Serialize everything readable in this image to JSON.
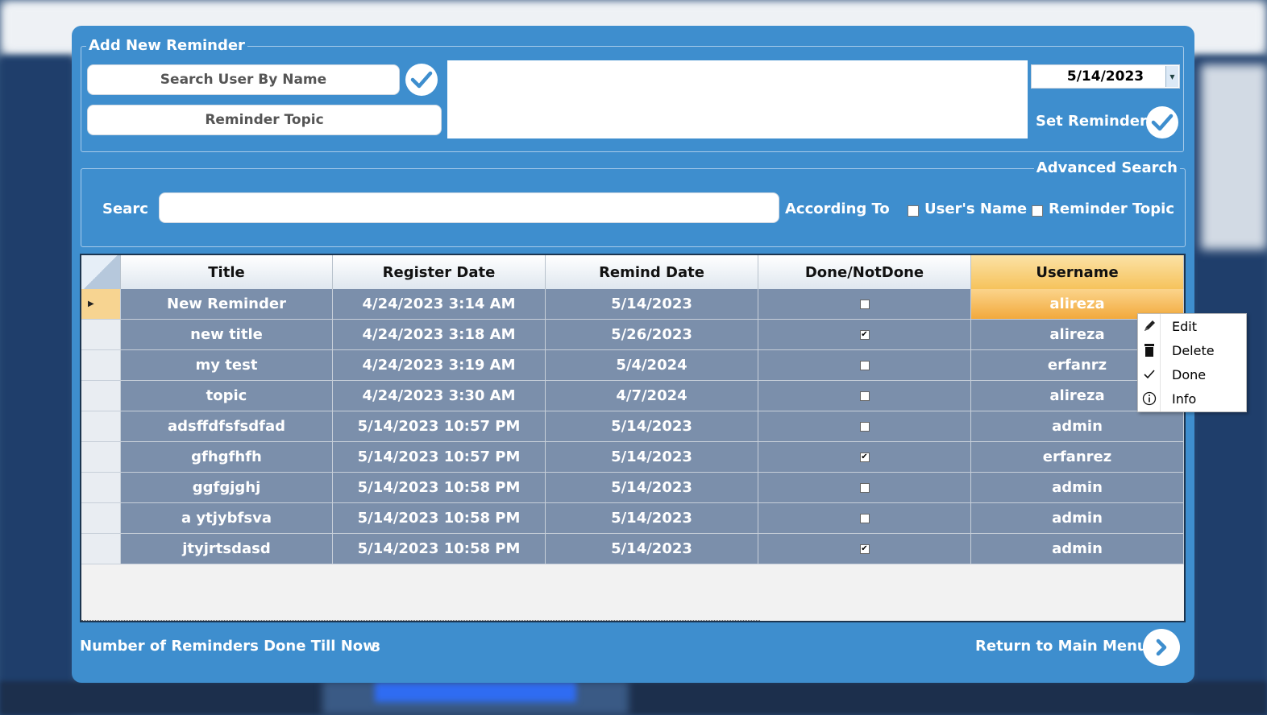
{
  "colors": {
    "dialog_bg": "#3e8ece",
    "grid_row_bg": "#7b8fab",
    "selected_cell": "#f6c35c",
    "accent_check": "#3e8ece"
  },
  "add_reminder": {
    "legend": "Add New Reminder",
    "search_user_placeholder": "Search User By Name",
    "topic_placeholder": "Reminder Topic",
    "date_value": "5/14/2023",
    "set_reminder_label": "Set Reminder"
  },
  "advanced_search": {
    "legend": "Advanced Search",
    "search_label": "Searc",
    "according_to_label": "According To",
    "option_users_name": "User's Name",
    "option_reminder_topic": "Reminder Topic"
  },
  "table": {
    "columns": [
      "Title",
      "Register Date",
      "Remind Date",
      "Done/NotDone",
      "Username"
    ],
    "rows": [
      {
        "title": "New Reminder",
        "register": "4/24/2023 3:14 AM",
        "remind": "5/14/2023",
        "done": false,
        "username": "alireza"
      },
      {
        "title": "new title",
        "register": "4/24/2023 3:18 AM",
        "remind": "5/26/2023",
        "done": true,
        "username": "alireza"
      },
      {
        "title": "my test",
        "register": "4/24/2023 3:19 AM",
        "remind": "5/4/2024",
        "done": false,
        "username": "erfanrz"
      },
      {
        "title": "topic",
        "register": "4/24/2023 3:30 AM",
        "remind": "4/7/2024",
        "done": false,
        "username": "alireza"
      },
      {
        "title": "adsffdfsfsdfad",
        "register": "5/14/2023 10:57 PM",
        "remind": "5/14/2023",
        "done": false,
        "username": "admin"
      },
      {
        "title": "gfhgfhfh",
        "register": "5/14/2023 10:57 PM",
        "remind": "5/14/2023",
        "done": true,
        "username": "erfanrez"
      },
      {
        "title": "ggfgjghj",
        "register": "5/14/2023 10:58 PM",
        "remind": "5/14/2023",
        "done": false,
        "username": "admin"
      },
      {
        "title": "a ytjybfsva",
        "register": "5/14/2023 10:58 PM",
        "remind": "5/14/2023",
        "done": false,
        "username": "admin"
      },
      {
        "title": "jtyjrtsdasd",
        "register": "5/14/2023 10:58 PM",
        "remind": "5/14/2023",
        "done": true,
        "username": "admin"
      }
    ]
  },
  "footer": {
    "done_count_label": "Number of Reminders Done Till Now",
    "done_count_value": "3",
    "return_label": "Return to Main Menu"
  },
  "context_menu": {
    "items": [
      {
        "label": "Edit",
        "icon": "pencil-icon"
      },
      {
        "label": "Delete",
        "icon": "trash-icon"
      },
      {
        "label": "Done",
        "icon": "checkmark-icon"
      },
      {
        "label": "Info",
        "icon": "info-icon"
      }
    ]
  }
}
